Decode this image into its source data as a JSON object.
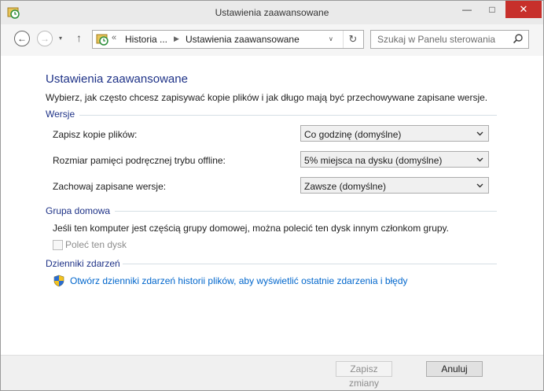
{
  "window": {
    "title": "Ustawienia zaawansowane",
    "minimize": "—",
    "maximize": "□",
    "close": "✕"
  },
  "nav": {
    "back": "←",
    "forward": "→",
    "recent": "▾",
    "up": "↑",
    "address_prefix": "«",
    "breadcrumbs": [
      "Historia ...",
      "Ustawienia zaawansowane"
    ],
    "breadcrumb_sep": "▶",
    "address_dropdown": "∨",
    "refresh": "↻",
    "search_placeholder": "Szukaj w Panelu sterowania"
  },
  "main": {
    "heading": "Ustawienia zaawansowane",
    "description": "Wybierz, jak często chcesz zapisywać kopie plików i jak długo mają być przechowywane zapisane wersje.",
    "versions": {
      "title": "Wersje",
      "rows": [
        {
          "label": "Zapisz kopie plików:",
          "value": "Co godzinę (domyślne)"
        },
        {
          "label": "Rozmiar pamięci podręcznej trybu offline:",
          "value": "5% miejsca na dysku (domyślne)"
        },
        {
          "label": "Zachowaj zapisane wersje:",
          "value": "Zawsze (domyślne)"
        }
      ]
    },
    "homegroup": {
      "title": "Grupa domowa",
      "note": "Jeśli ten komputer jest częścią grupy domowej, można polecić ten dysk innym członkom grupy.",
      "checkbox_label": "Poleć ten dysk"
    },
    "events": {
      "title": "Dzienniki zdarzeń",
      "link": "Otwórz dzienniki zdarzeń historii plików, aby wyświetlić ostatnie zdarzenia i błędy"
    }
  },
  "footer": {
    "save": "Zapisz zmiany",
    "cancel": "Anuluj"
  },
  "colors": {
    "heading": "#1e3287",
    "link": "#0066cc",
    "close_button": "#c7302b"
  }
}
